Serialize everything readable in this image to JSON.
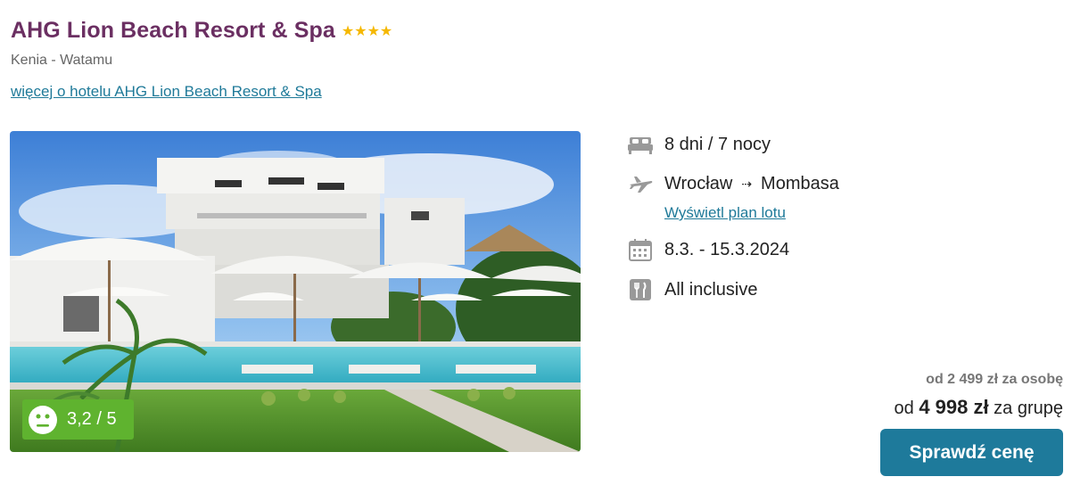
{
  "hotel": {
    "name": "AHG Lion Beach Resort & Spa",
    "stars": 4,
    "location": "Kenia - Watamu",
    "more_link": "więcej o hotelu AHG Lion Beach Resort & Spa",
    "rating": "3,2 / 5"
  },
  "trip": {
    "duration": "8 dni / 7 nocy",
    "from": "Wrocław",
    "arrow": "⇢",
    "to": "Mombasa",
    "flight_link": "Wyświetl plan lotu",
    "dates": "8.3. - 15.3.2024",
    "board": "All inclusive"
  },
  "price": {
    "per_person": "od 2 499 zł za osobę",
    "group_prefix": "od",
    "group_amount": "4 998 zł",
    "group_suffix": "za grupę"
  },
  "cta": {
    "label": "Sprawdź cenę"
  },
  "colors": {
    "title": "#6b2f62",
    "link": "#1f7a99",
    "button": "#1e7a9b",
    "rating_badge": "#5fb32f",
    "star": "#f5b800"
  },
  "icons": [
    "star-icon",
    "smiley-icon",
    "bed-icon",
    "plane-icon",
    "calendar-icon",
    "cutlery-icon"
  ]
}
